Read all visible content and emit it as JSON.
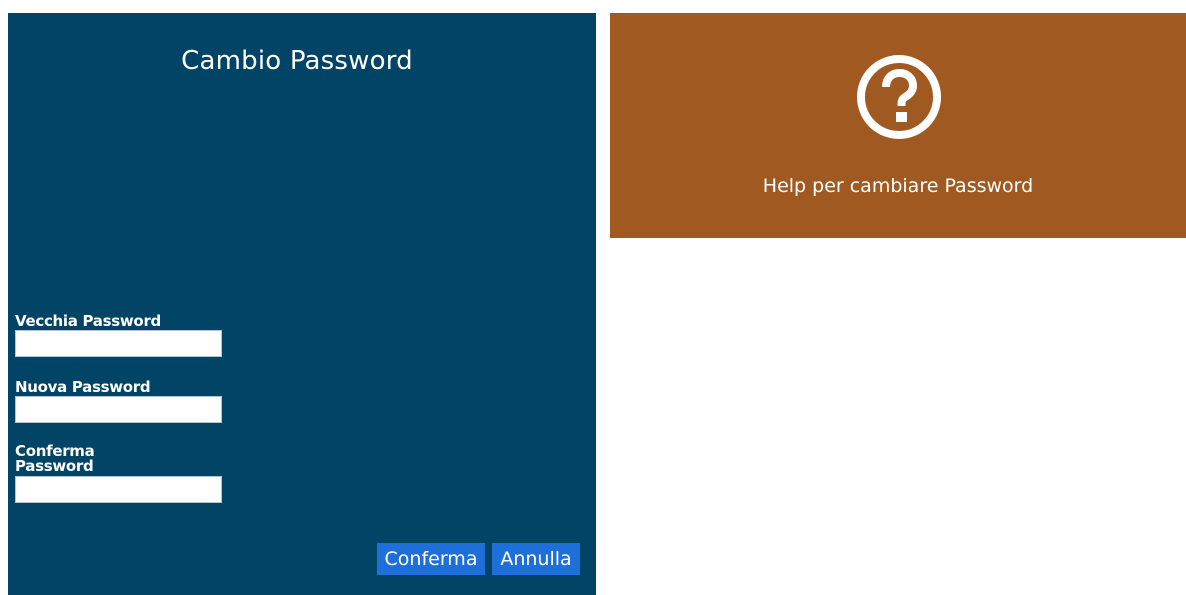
{
  "left_panel": {
    "title": "Cambio Password",
    "fields": {
      "old_password_label": "Vecchia Password",
      "old_password_value": "",
      "new_password_label": "Nuova Password",
      "new_password_value": "",
      "confirm_password_label": "Conferma Password",
      "confirm_password_value": ""
    },
    "buttons": {
      "confirm_label": "Conferma",
      "cancel_label": "Annulla"
    },
    "background_color": "#014465"
  },
  "help_panel": {
    "icon": "question-circle-icon",
    "text": "Help per cambiare Password",
    "background_color": "#a05a21"
  },
  "colors": {
    "button": "#1e6fd9",
    "text": "#ffffff"
  }
}
